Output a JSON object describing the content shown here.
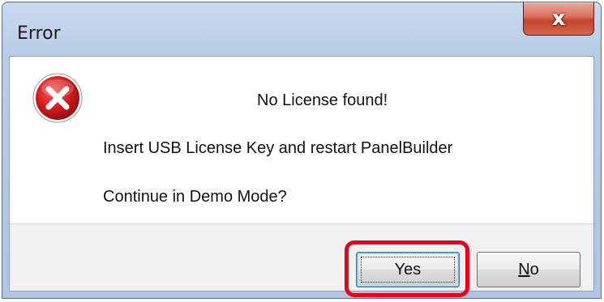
{
  "window": {
    "title": "Error",
    "close_icon": "close-icon"
  },
  "dialog": {
    "icon": "error-icon",
    "heading": "No License found!",
    "line1": "Insert USB License Key and restart PanelBuilder",
    "line2": "Continue in Demo Mode?"
  },
  "buttons": {
    "yes_label": "Yes",
    "no_label_accel": "N",
    "no_label_rest": "o"
  },
  "colors": {
    "highlight": "#e8001c",
    "error_red": "#c8171c",
    "close_button": "#c4432a"
  }
}
